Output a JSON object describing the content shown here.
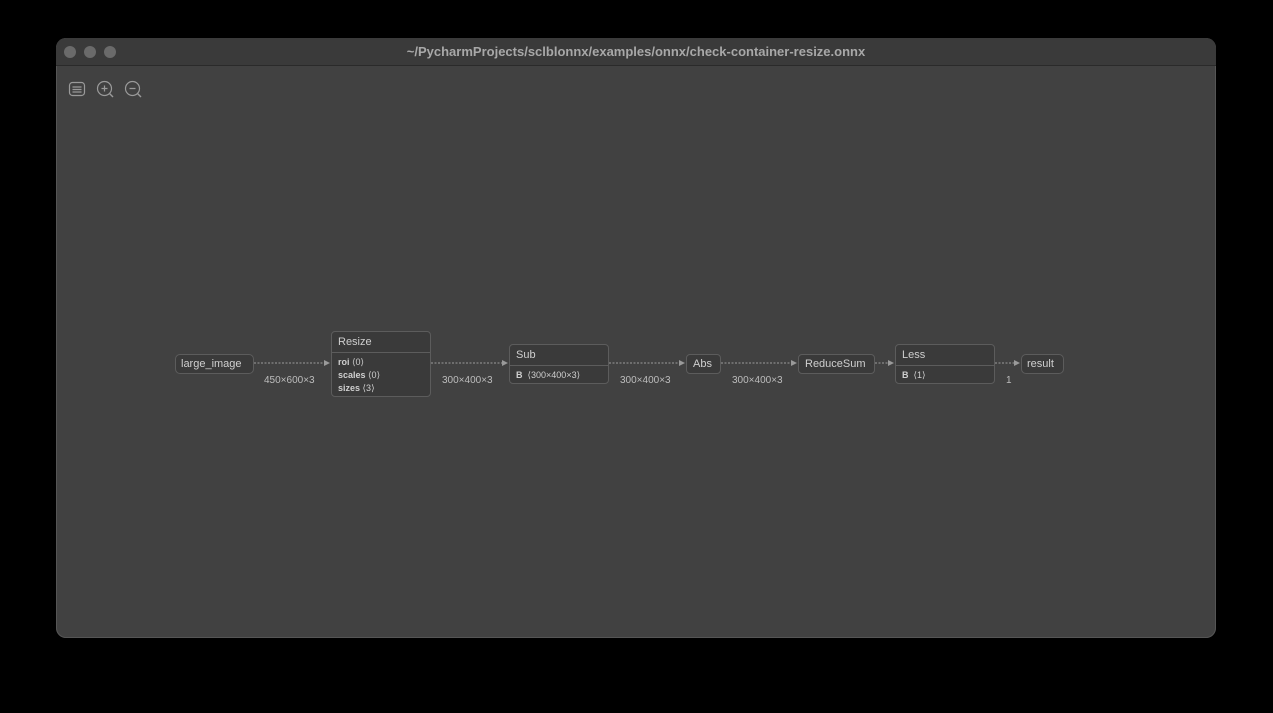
{
  "window": {
    "title": "~/PycharmProjects/sclblonnx/examples/onnx/check-container-resize.onnx"
  },
  "toolbar": {
    "buttons": [
      {
        "icon": "sidebar-icon"
      },
      {
        "icon": "zoom-in-icon"
      },
      {
        "icon": "zoom-out-icon"
      }
    ]
  },
  "graph": {
    "input": {
      "label": "large_image"
    },
    "resize": {
      "label": "Resize",
      "attrs": [
        {
          "key": "roi",
          "value": "⟨0⟩"
        },
        {
          "key": "scales",
          "value": "⟨0⟩"
        },
        {
          "key": "sizes",
          "value": "⟨3⟩"
        }
      ]
    },
    "sub": {
      "label": "Sub",
      "attrs": [
        {
          "key": "B",
          "value": "⟨300×400×3⟩"
        }
      ]
    },
    "abs": {
      "label": "Abs"
    },
    "reducesum": {
      "label": "ReduceSum"
    },
    "less": {
      "label": "Less",
      "attrs": [
        {
          "key": "B",
          "value": "⟨1⟩"
        }
      ]
    },
    "output": {
      "label": "result"
    },
    "edges": [
      {
        "label": "450×600×3"
      },
      {
        "label": "300×400×3"
      },
      {
        "label": "300×400×3"
      },
      {
        "label": "300×400×3"
      },
      {
        "label": ""
      },
      {
        "label": "1"
      }
    ]
  }
}
